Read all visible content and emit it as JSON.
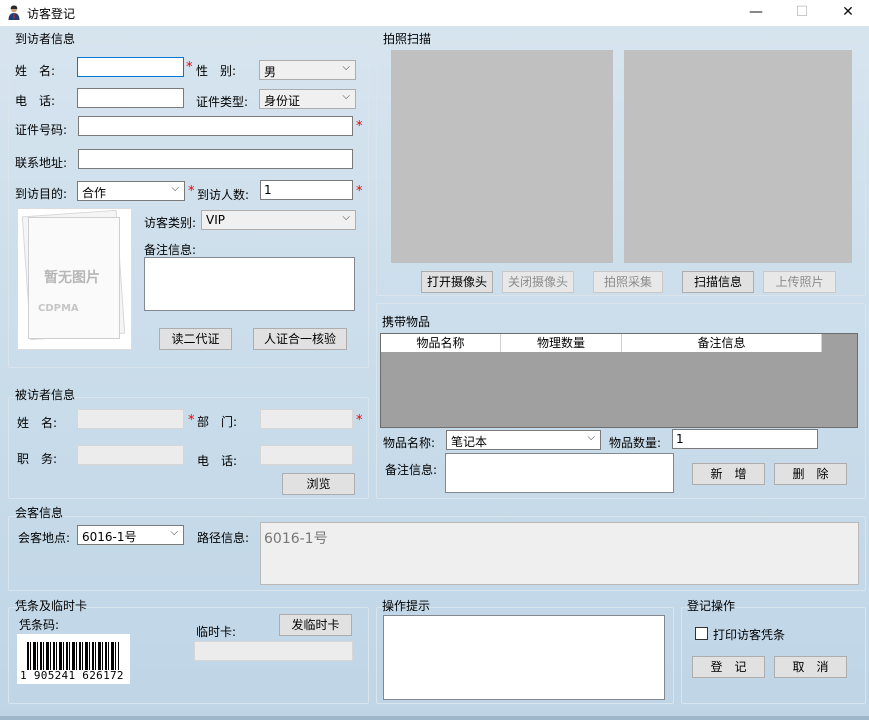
{
  "window": {
    "title": "访客登记",
    "minimize": "—",
    "maximize": "☐",
    "close": "✕"
  },
  "visitor": {
    "group_title": "到访者信息",
    "name_label": "姓　名:",
    "name_value": "",
    "gender_label": "性　别:",
    "gender_value": "男",
    "phone_label": "电　话:",
    "phone_value": "",
    "idtype_label": "证件类型:",
    "idtype_value": "身份证",
    "idnum_label": "证件号码:",
    "idnum_value": "",
    "address_label": "联系地址:",
    "address_value": "",
    "purpose_label": "到访目的:",
    "purpose_value": "合作",
    "count_label": "到访人数:",
    "count_value": "1",
    "category_label": "访客类别:",
    "category_value": "VIP",
    "remark_label": "备注信息:",
    "photo_placeholder": "暂无图片",
    "photo_brand": "CDPMA",
    "read_id_button": "读二代证",
    "verify_button": "人证合一核验"
  },
  "camera": {
    "group_title": "拍照扫描",
    "open_button": "打开摄像头",
    "close_button": "关闭摄像头",
    "capture_button": "拍照采集",
    "scan_button": "扫描信息",
    "upload_button": "上传照片"
  },
  "items": {
    "group_title": "携带物品",
    "columns": [
      "物品名称",
      "物理数量",
      "备注信息"
    ],
    "name_label": "物品名称:",
    "name_value": "笔记本",
    "qty_label": "物品数量:",
    "qty_value": "1",
    "remark_label": "备注信息:",
    "add_button": "新　增",
    "delete_button": "删　除"
  },
  "host": {
    "group_title": "被访者信息",
    "name_label": "姓　名:",
    "dept_label": "部　门:",
    "title_label": "职　务:",
    "phone_label": "电　话:",
    "browse_button": "浏览"
  },
  "meeting": {
    "group_title": "会客信息",
    "place_label": "会客地点:",
    "place_value": "6016-1号",
    "route_label": "路径信息:",
    "route_value": "6016-1号"
  },
  "voucher": {
    "group_title": "凭条及临时卡",
    "code_label": "凭条码:",
    "barcode_number": "1 905241 626172",
    "tempcard_label": "临时卡:",
    "issue_button": "发临时卡"
  },
  "hint": {
    "group_title": "操作提示"
  },
  "register": {
    "group_title": "登记操作",
    "print_label": "打印访客凭条",
    "submit_button": "登　记",
    "cancel_button": "取　消"
  },
  "required_mark": "*"
}
